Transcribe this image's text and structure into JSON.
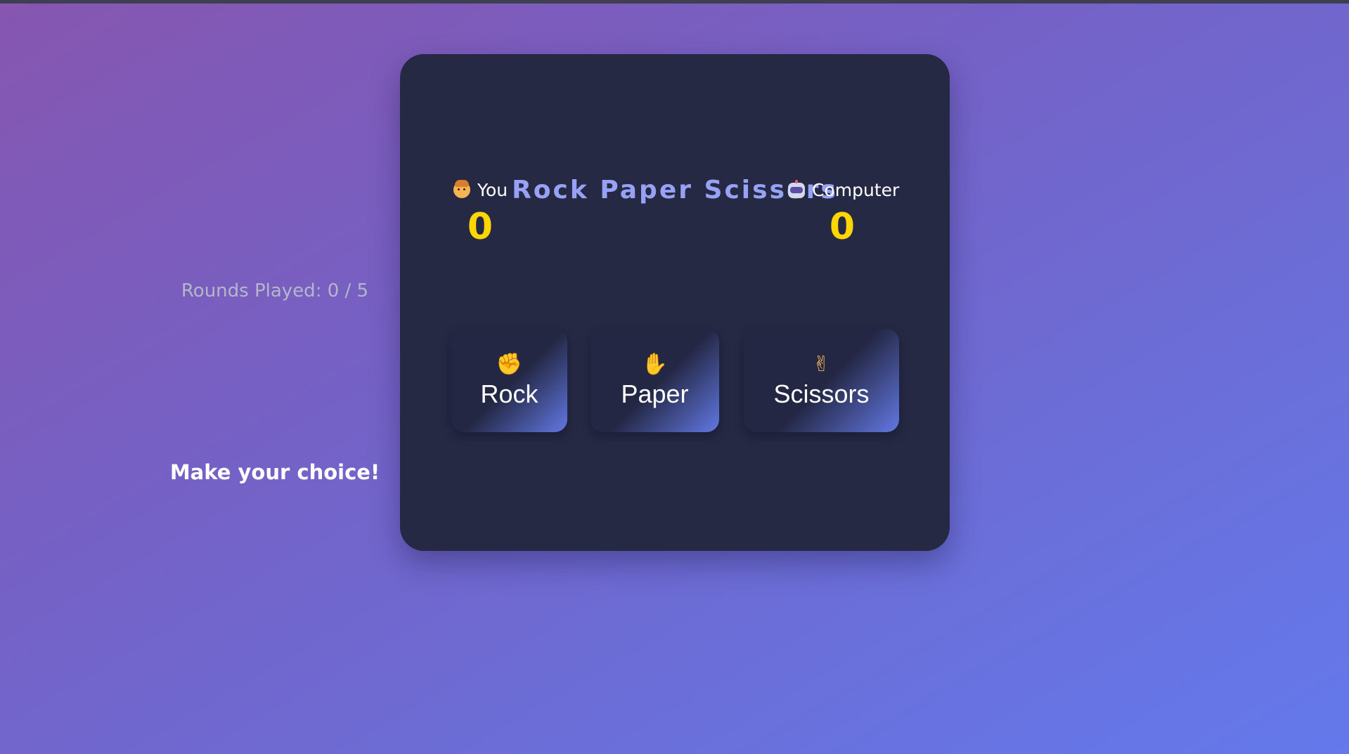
{
  "colors": {
    "title": "#97a2f6",
    "score": "#ffd600",
    "card_background": "#262944",
    "button_accent": "#6278e3"
  },
  "game": {
    "title": "Rock Paper Scissors",
    "player": {
      "icon": "person-face-icon",
      "label": "You",
      "score": "0"
    },
    "computer": {
      "icon": "robot-face-icon",
      "label": "Computer",
      "score": "0"
    },
    "rounds_text": "Rounds Played: 0 / 5",
    "choices": [
      {
        "icon": "raised-fist-icon",
        "glyph": "✊",
        "label": "Rock"
      },
      {
        "icon": "raised-hand-icon",
        "glyph": "✋",
        "label": "Paper"
      },
      {
        "icon": "victory-hand-icon",
        "glyph": "✌",
        "label": "Scissors"
      }
    ],
    "message": "Make your choice!"
  }
}
